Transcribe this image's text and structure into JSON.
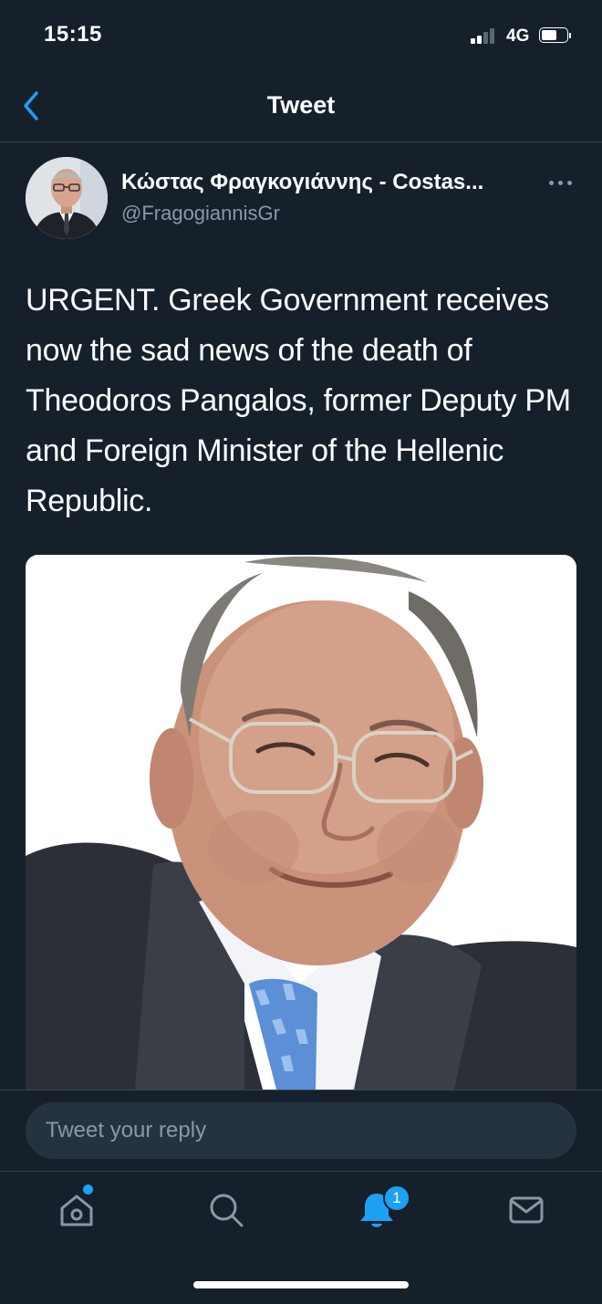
{
  "status_bar": {
    "time": "15:15",
    "network": "4G",
    "signal_icon": "signal-bars-icon",
    "battery_icon": "battery-icon"
  },
  "header": {
    "title": "Tweet",
    "back_icon": "chevron-left-icon"
  },
  "tweet": {
    "author_name": "Κώστας Φραγκογιάννης - Costas...",
    "author_handle": "@FragogiannisGr",
    "more_icon": "more-horizontal-icon",
    "text": "URGENT. Greek Government receives now the sad news of the death of Theodoros Pangalos, former Deputy PM and Foreign Minister of the Hellenic Republic."
  },
  "reply": {
    "placeholder": "Tweet your reply"
  },
  "tab_bar": {
    "tabs": [
      {
        "name": "home",
        "icon": "home-icon"
      },
      {
        "name": "search",
        "icon": "search-icon"
      },
      {
        "name": "notifications",
        "icon": "bell-icon",
        "badge": "1"
      },
      {
        "name": "messages",
        "icon": "mail-icon"
      }
    ],
    "notifications_badge": "1"
  },
  "colors": {
    "background": "#15202b",
    "accent": "#1da1f2",
    "secondary_text": "#8899a6",
    "divider": "#38444d"
  }
}
